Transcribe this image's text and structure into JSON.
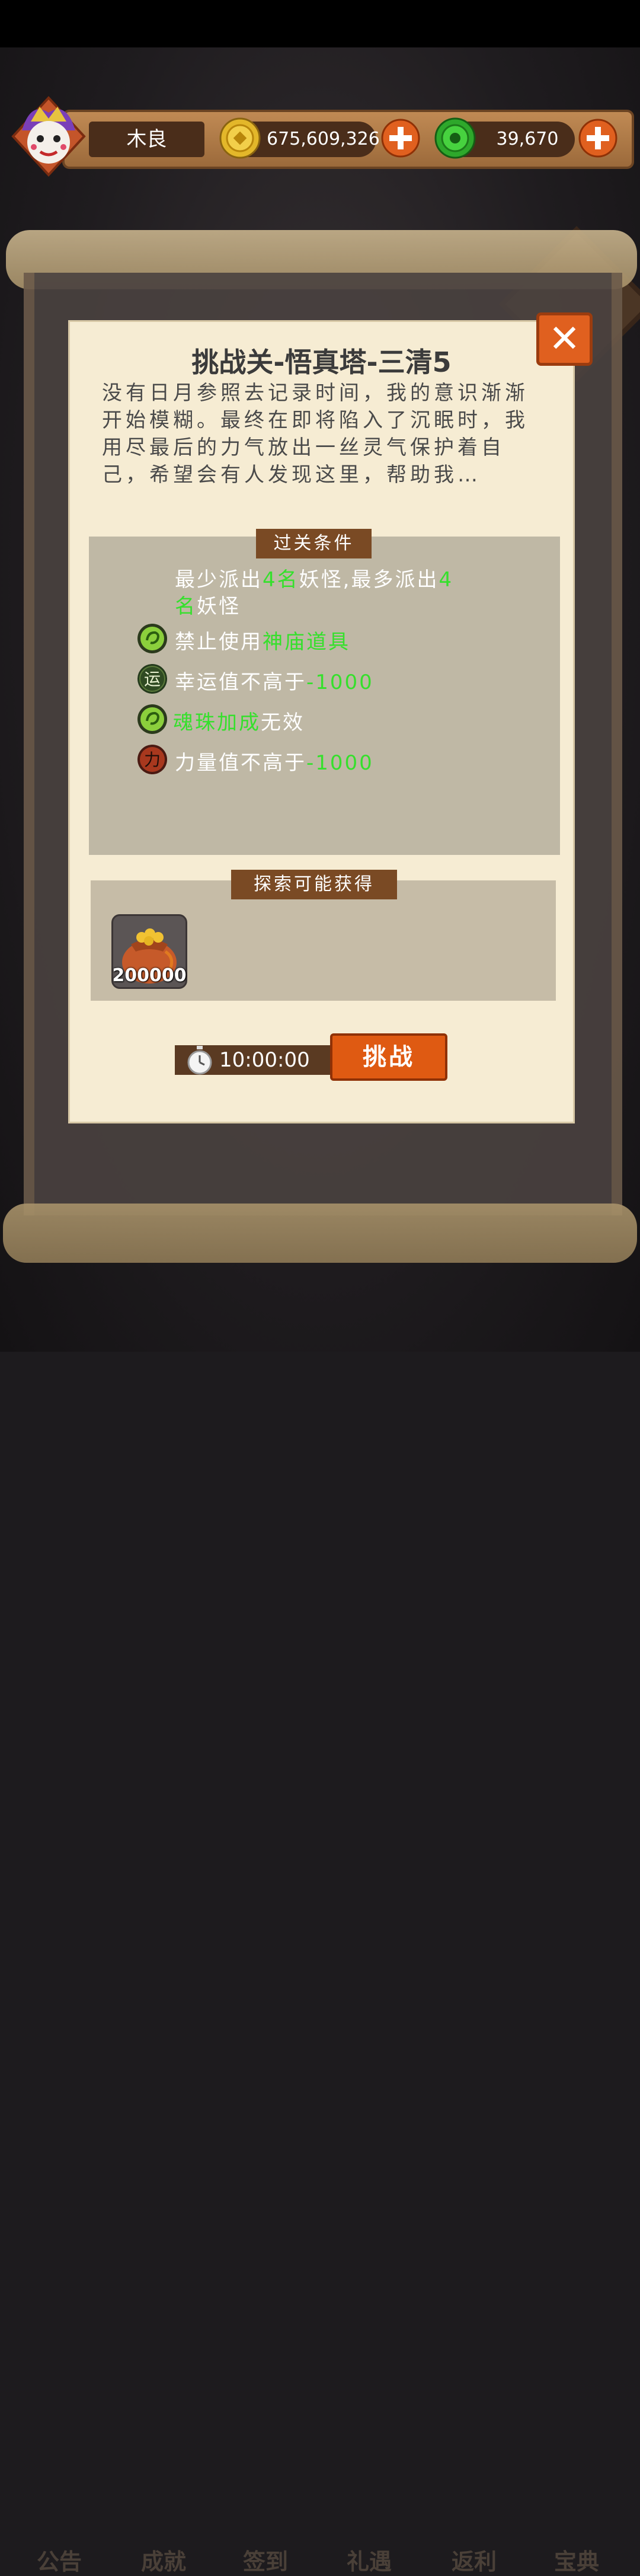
{
  "player": {
    "name": "木良",
    "gold": "675,609,326",
    "jade": "39,670"
  },
  "dialog": {
    "title": "挑战关-悟真塔-三清5",
    "description": "没有日月参照去记录时间，我的意识渐渐开始模糊。最终在即将陷入了沉眠时，我用尽最后的力气放出一丝灵气保护着自己，希望会有人发现这里，帮助我…",
    "conditions_title": "过关条件",
    "conditions": [
      {
        "icon": "none",
        "parts": [
          [
            "最少派出",
            ""
          ],
          [
            "4名",
            "hl"
          ],
          [
            "妖怪,最多派出",
            ""
          ],
          [
            "4",
            "hl"
          ]
        ],
        "line2": [
          [
            "名",
            "hl"
          ],
          [
            "妖怪",
            ""
          ]
        ]
      },
      {
        "icon": "green-orb-icon",
        "parts": [
          [
            "禁止使用",
            ""
          ],
          [
            "神庙道具",
            "hl"
          ]
        ]
      },
      {
        "icon": "luck-icon",
        "glyph": "运",
        "parts": [
          [
            "幸运值不高于",
            ""
          ],
          [
            "-1000",
            "hl"
          ]
        ]
      },
      {
        "icon": "green-orb-icon",
        "parts": [
          [
            "魂珠加成",
            "hl"
          ],
          [
            "无效",
            ""
          ]
        ]
      },
      {
        "icon": "power-icon",
        "glyph": "力",
        "parts": [
          [
            "力量值不高于",
            ""
          ],
          [
            "-1000",
            "hl"
          ]
        ]
      }
    ],
    "rewards_title": "探索可能获得",
    "rewards": [
      {
        "icon": "coin-bag-icon",
        "count": "200000"
      }
    ],
    "timer": "10:00:00",
    "challenge_label": "挑战"
  },
  "background": {
    "nav": [
      "公告",
      "成就",
      "签到",
      "礼遇",
      "返利",
      "宝典"
    ]
  },
  "colors": {
    "highlight": "#35e02c",
    "accent": "#df5a12"
  }
}
